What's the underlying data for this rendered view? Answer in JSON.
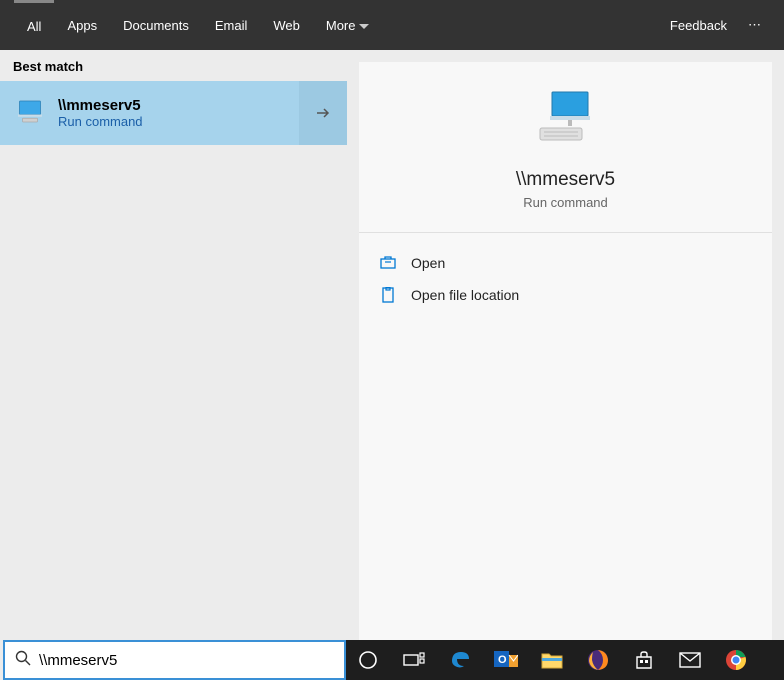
{
  "tabs": {
    "all": "All",
    "apps": "Apps",
    "documents": "Documents",
    "email": "Email",
    "web": "Web",
    "more": "More",
    "feedback": "Feedback"
  },
  "sectionLabel": "Best match",
  "result": {
    "title": "\\\\mmeserv5",
    "subtitle": "Run command"
  },
  "detail": {
    "title": "\\\\mmeserv5",
    "subtitle": "Run command"
  },
  "actions": {
    "open": "Open",
    "openLocation": "Open file location"
  },
  "search": {
    "value": "\\\\mmeserv5",
    "placeholder": ""
  }
}
